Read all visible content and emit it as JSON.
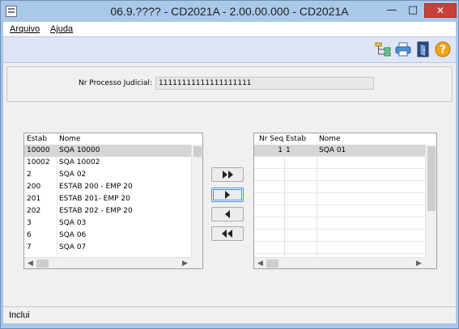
{
  "window": {
    "title": "06.9.???? - CD2021A - 2.00.00.000 - CD2021A"
  },
  "menu": {
    "arquivo": "Arquivo",
    "ajuda": "Ajuda"
  },
  "process": {
    "label": "Nr Processo Judicial:",
    "value": "11111111111111111111"
  },
  "left_list": {
    "headers": [
      "Estab",
      "Nome"
    ],
    "rows": [
      {
        "estab": "10000",
        "nome": "SQA 10000",
        "selected": true
      },
      {
        "estab": "10002",
        "nome": "SQA 10002"
      },
      {
        "estab": "2",
        "nome": "SQA 02"
      },
      {
        "estab": "200",
        "nome": "ESTAB 200 - EMP 20"
      },
      {
        "estab": "201",
        "nome": "ESTAB 201- EMP 20"
      },
      {
        "estab": "202",
        "nome": "ESTAB 202 - EMP 20"
      },
      {
        "estab": "3",
        "nome": "SQA 03"
      },
      {
        "estab": "6",
        "nome": "SQA 06"
      },
      {
        "estab": "7",
        "nome": "SQA 07"
      }
    ]
  },
  "right_list": {
    "headers": [
      "Nr Seq",
      "Estab",
      "Nome"
    ],
    "rows": [
      {
        "seq": "1",
        "estab": "1",
        "nome": "SQA 01",
        "selected": true
      }
    ]
  },
  "transfer_buttons": [
    "move-all-right",
    "move-right",
    "move-left",
    "move-all-left"
  ],
  "toolbar_icons": [
    "tree-icon",
    "printer-icon",
    "exit-door-icon",
    "help-icon"
  ],
  "status": {
    "text": "Inclui"
  }
}
